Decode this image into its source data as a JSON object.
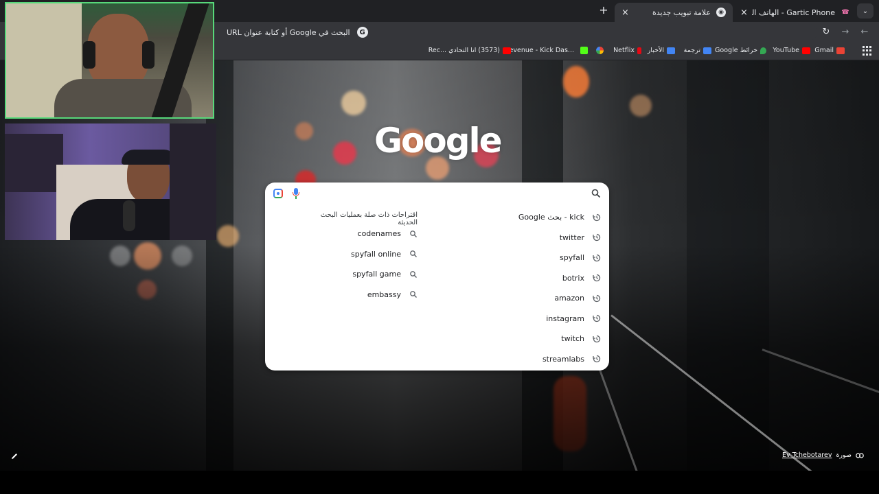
{
  "browser": {
    "tabs": [
      {
        "title": "Gartic Phone - الهاتف المكسور",
        "active": false,
        "favicon": "gartic-phone-icon"
      },
      {
        "title": "علامة تبويب جديدة",
        "active": true,
        "favicon": "chrome-icon"
      }
    ],
    "address_bar": {
      "placeholder": "البحث في Google أو كتابة عنوان URL"
    },
    "bookmarks": [
      {
        "label": "Gmail",
        "icon": "gmail-icon",
        "color": "#ea4335"
      },
      {
        "label": "YouTube",
        "icon": "youtube-icon",
        "color": "#ff0000"
      },
      {
        "label": "خرائط Google",
        "icon": "maps-icon",
        "color": "#34a853"
      },
      {
        "label": "ترجمة",
        "icon": "translate-icon",
        "color": "#4285f4"
      },
      {
        "label": "الأخبار",
        "icon": "news-icon",
        "color": "#4285f4"
      },
      {
        "label": "Netflix",
        "icon": "netflix-icon",
        "color": "#e50914"
      },
      {
        "label": "",
        "icon": "photos-icon",
        "color": "#fbbc05"
      },
      {
        "label": "",
        "icon": "kick-icon",
        "color": "#53fc18"
      },
      {
        "label": "Revenue - Kick Das...",
        "icon": "kick-dashboard-icon",
        "color": "#53fc18"
      },
      {
        "label": "(3573) انا التحادي ...Rec",
        "icon": "youtube-icon",
        "color": "#ff0000"
      }
    ]
  },
  "new_tab": {
    "logo": "Google",
    "search_input": {
      "value": "",
      "placeholder": ""
    },
    "recent_searches": [
      {
        "text": "kick - بحث Google"
      },
      {
        "text": "twitter"
      },
      {
        "text": "spyfall"
      },
      {
        "text": "botrix"
      },
      {
        "text": "amazon"
      },
      {
        "text": "instagram"
      },
      {
        "text": "twitch"
      },
      {
        "text": "streamlabs"
      }
    ],
    "related_heading": "اقتراحات ذات صلة بعمليات البحث الحديثة",
    "related_searches": [
      {
        "text": "codenames"
      },
      {
        "text": "spyfall online"
      },
      {
        "text": "spyfall game"
      },
      {
        "text": "embassy"
      }
    ],
    "photo_credit": {
      "prefix": "صورة",
      "author": "Ev Tchebotarev"
    }
  },
  "colors": {
    "chrome_dark": "#202124",
    "chrome_toolbar": "#35363a",
    "webcam_border": "#57d97a",
    "google_blue": "#4285f4",
    "google_red": "#ea4335",
    "google_green": "#34a853"
  }
}
